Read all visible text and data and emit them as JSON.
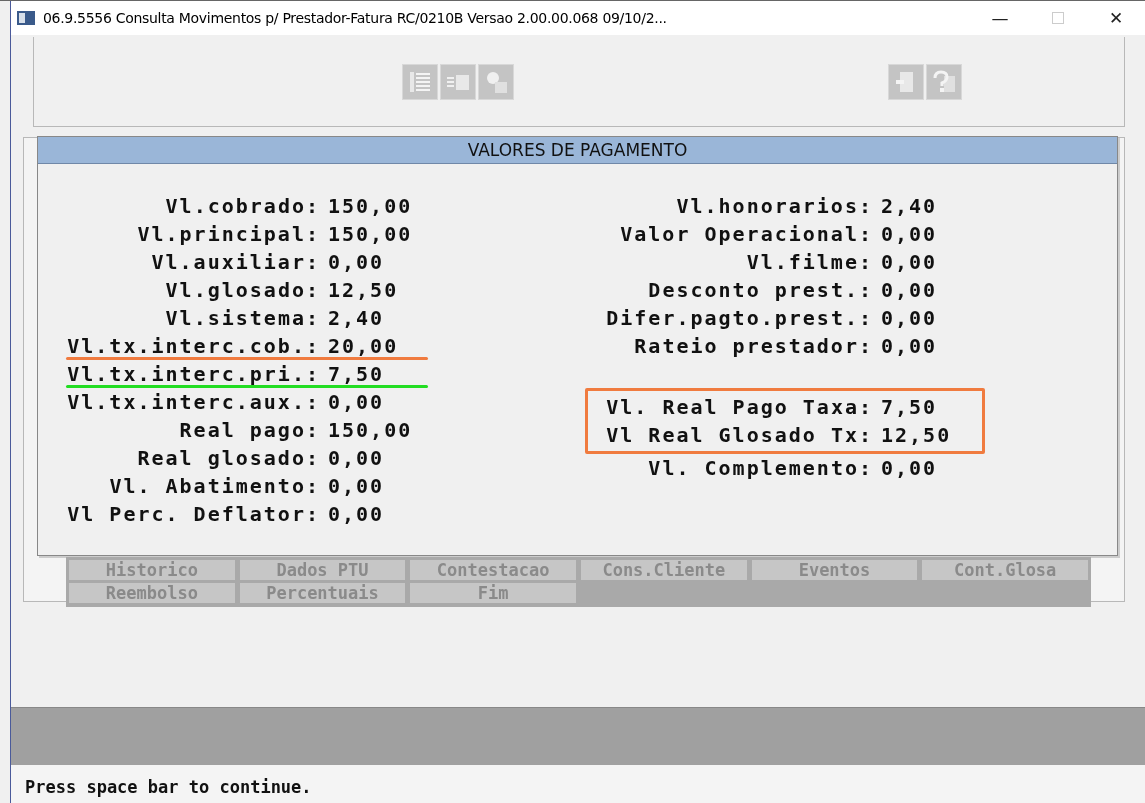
{
  "window": {
    "title": "06.9.5556 Consulta Movimentos p/ Prestador-Fatura RC/0210B Versao 2.00.00.068 09/10/2...",
    "minimize": "—",
    "close": "✕"
  },
  "dialog": {
    "title": "VALORES DE PAGAMENTO",
    "left": [
      {
        "label": "Vl.cobrado:",
        "value": "150,00"
      },
      {
        "label": "Vl.principal:",
        "value": "150,00"
      },
      {
        "label": "Vl.auxiliar:",
        "value": "0,00"
      },
      {
        "label": "Vl.glosado:",
        "value": "12,50"
      },
      {
        "label": "Vl.sistema:",
        "value": "2,40"
      },
      {
        "label": "Vl.tx.interc.cob.:",
        "value": "20,00",
        "color": "#f07b3f"
      },
      {
        "label": "Vl.tx.interc.pri.:",
        "value": "7,50",
        "color": "#22dd22"
      },
      {
        "label": "Vl.tx.interc.aux.:",
        "value": "0,00"
      },
      {
        "label": "Real pago:",
        "value": "150,00"
      },
      {
        "label": "Real glosado:",
        "value": "0,00"
      },
      {
        "label": "Vl. Abatimento:",
        "value": "0,00"
      },
      {
        "label": "Vl Perc. Deflator:",
        "value": "0,00"
      }
    ],
    "right": [
      {
        "label": "Vl.honorarios:",
        "value": "2,40",
        "boxed": false
      },
      {
        "label": "Valor Operacional:",
        "value": "0,00",
        "boxed": false
      },
      {
        "label": "Vl.filme:",
        "value": "0,00",
        "boxed": false
      },
      {
        "label": "Desconto prest.:",
        "value": "0,00",
        "boxed": false
      },
      {
        "label": "Difer.pagto.prest.:",
        "value": "0,00",
        "boxed": false
      },
      {
        "label": "Rateio prestador:",
        "value": "0,00",
        "boxed": false
      },
      {
        "label": "Vl. Real Pago Taxa:",
        "value": "7,50",
        "boxed": true
      },
      {
        "label": "Vl Real Glosado Tx:",
        "value": "12,50",
        "boxed": true
      },
      {
        "label": "Vl. Complemento:",
        "value": "0,00",
        "boxed": false
      }
    ]
  },
  "menu": [
    "Historico",
    "Dados PTU",
    "Contestacao",
    "Cons.Cliente",
    "Eventos",
    "Cont.Glosa",
    "Reembolso",
    "Percentuais",
    "Fim"
  ],
  "status": "Press space bar to continue."
}
